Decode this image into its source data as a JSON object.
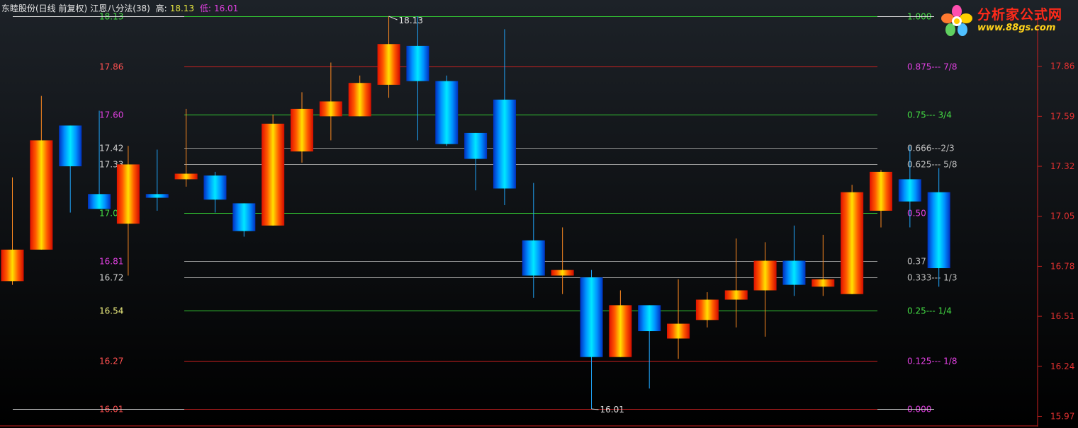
{
  "header": {
    "stock_name": "东睦股份(日线 前复权)",
    "indicator": "江恩八分法(38)",
    "high_label": "高:",
    "high_value": "18.13",
    "low_label": "低:",
    "low_value": "16.01"
  },
  "logo": {
    "title": "分析家公式网",
    "url": "www.88gs.com"
  },
  "colors": {
    "background": "#000000",
    "green_line": "#33cc33",
    "red_line": "#cc2020",
    "gray_line": "#9a9a9a",
    "magenta_text": "#e040e0",
    "bull_candle": "#ff2200",
    "bear_candle": "#00aaff",
    "axis_red": "#cc2020"
  },
  "chart_data": {
    "type": "candlestick",
    "ylim": [
      15.96,
      18.18
    ],
    "right_axis_ticks": [
      "17.86",
      "17.59",
      "17.32",
      "17.05",
      "16.78",
      "16.51",
      "16.24",
      "15.97"
    ],
    "high_marker": "18.13",
    "low_marker": "16.01",
    "gann_levels": [
      {
        "price": 18.13,
        "left_label": "18.13",
        "ratio_label": "1.000",
        "color": "green"
      },
      {
        "price": 17.86,
        "left_label": "17.86",
        "ratio_label": "0.875--- 7/8",
        "color": "red"
      },
      {
        "price": 17.6,
        "left_label": "17.60",
        "ratio_label": "0.75--- 3/4",
        "color": "green"
      },
      {
        "price": 17.42,
        "left_label": "17.42",
        "ratio_label": "0.666---2/3",
        "color": "gray"
      },
      {
        "price": 17.33,
        "left_label": "17.33",
        "ratio_label": "0.625--- 5/8",
        "color": "gray"
      },
      {
        "price": 17.07,
        "left_label": "17.0",
        "ratio_label": "0.50",
        "color": "green"
      },
      {
        "price": 16.81,
        "left_label": "16.81",
        "ratio_label": "0.37 /8",
        "color": "gray"
      },
      {
        "price": 16.72,
        "left_label": "16.72",
        "ratio_label": "0.333--- 1/3",
        "color": "gray"
      },
      {
        "price": 16.54,
        "left_label": "16.54",
        "ratio_label": "0.25--- 1/4",
        "color": "green"
      },
      {
        "price": 16.27,
        "left_label": "16.27",
        "ratio_label": "0.125--- 1/8",
        "color": "red"
      },
      {
        "price": 16.01,
        "left_label": "16.01",
        "ratio_label": "0.000",
        "color": "red"
      }
    ],
    "candles": [
      {
        "o": 16.7,
        "c": 16.87,
        "h": 17.26,
        "l": 16.68
      },
      {
        "o": 16.87,
        "c": 17.46,
        "h": 17.7,
        "l": 16.87
      },
      {
        "o": 17.54,
        "c": 17.32,
        "h": 17.54,
        "l": 17.07
      },
      {
        "o": 17.17,
        "c": 17.09,
        "h": 17.62,
        "l": 17.09
      },
      {
        "o": 17.01,
        "c": 17.33,
        "h": 17.43,
        "l": 16.73
      },
      {
        "o": 17.17,
        "c": 17.15,
        "h": 17.41,
        "l": 17.08
      },
      {
        "o": 17.25,
        "c": 17.28,
        "h": 17.63,
        "l": 17.21
      },
      {
        "o": 17.27,
        "c": 17.14,
        "h": 17.29,
        "l": 17.07
      },
      {
        "o": 17.12,
        "c": 16.97,
        "h": 17.12,
        "l": 16.94
      },
      {
        "o": 17.0,
        "c": 17.55,
        "h": 17.6,
        "l": 17.0
      },
      {
        "o": 17.4,
        "c": 17.63,
        "h": 17.72,
        "l": 17.34
      },
      {
        "o": 17.59,
        "c": 17.67,
        "h": 17.88,
        "l": 17.46
      },
      {
        "o": 17.59,
        "c": 17.77,
        "h": 17.81,
        "l": 17.59
      },
      {
        "o": 17.76,
        "c": 17.98,
        "h": 18.13,
        "l": 17.69
      },
      {
        "o": 17.97,
        "c": 17.78,
        "h": 18.13,
        "l": 17.46
      },
      {
        "o": 17.78,
        "c": 17.44,
        "h": 17.81,
        "l": 17.43
      },
      {
        "o": 17.5,
        "c": 17.36,
        "h": 17.5,
        "l": 17.19
      },
      {
        "o": 17.68,
        "c": 17.2,
        "h": 18.06,
        "l": 17.11
      },
      {
        "o": 16.92,
        "c": 16.73,
        "h": 17.23,
        "l": 16.61
      },
      {
        "o": 16.73,
        "c": 16.76,
        "h": 16.99,
        "l": 16.63
      },
      {
        "o": 16.72,
        "c": 16.29,
        "h": 16.76,
        "l": 16.01
      },
      {
        "o": 16.29,
        "c": 16.57,
        "h": 16.65,
        "l": 16.29
      },
      {
        "o": 16.57,
        "c": 16.43,
        "h": 16.57,
        "l": 16.12
      },
      {
        "o": 16.39,
        "c": 16.47,
        "h": 16.71,
        "l": 16.28
      },
      {
        "o": 16.49,
        "c": 16.6,
        "h": 16.64,
        "l": 16.45
      },
      {
        "o": 16.6,
        "c": 16.65,
        "h": 16.93,
        "l": 16.45
      },
      {
        "o": 16.65,
        "c": 16.81,
        "h": 16.91,
        "l": 16.4
      },
      {
        "o": 16.81,
        "c": 16.68,
        "h": 17.0,
        "l": 16.62
      },
      {
        "o": 16.67,
        "c": 16.71,
        "h": 16.95,
        "l": 16.62
      },
      {
        "o": 16.63,
        "c": 17.18,
        "h": 17.22,
        "l": 16.63
      },
      {
        "o": 17.08,
        "c": 17.29,
        "h": 17.3,
        "l": 16.99
      },
      {
        "o": 17.25,
        "c": 17.13,
        "h": 17.43,
        "l": 16.99
      },
      {
        "o": 17.18,
        "c": 16.77,
        "h": 17.31,
        "l": 16.67
      }
    ]
  }
}
